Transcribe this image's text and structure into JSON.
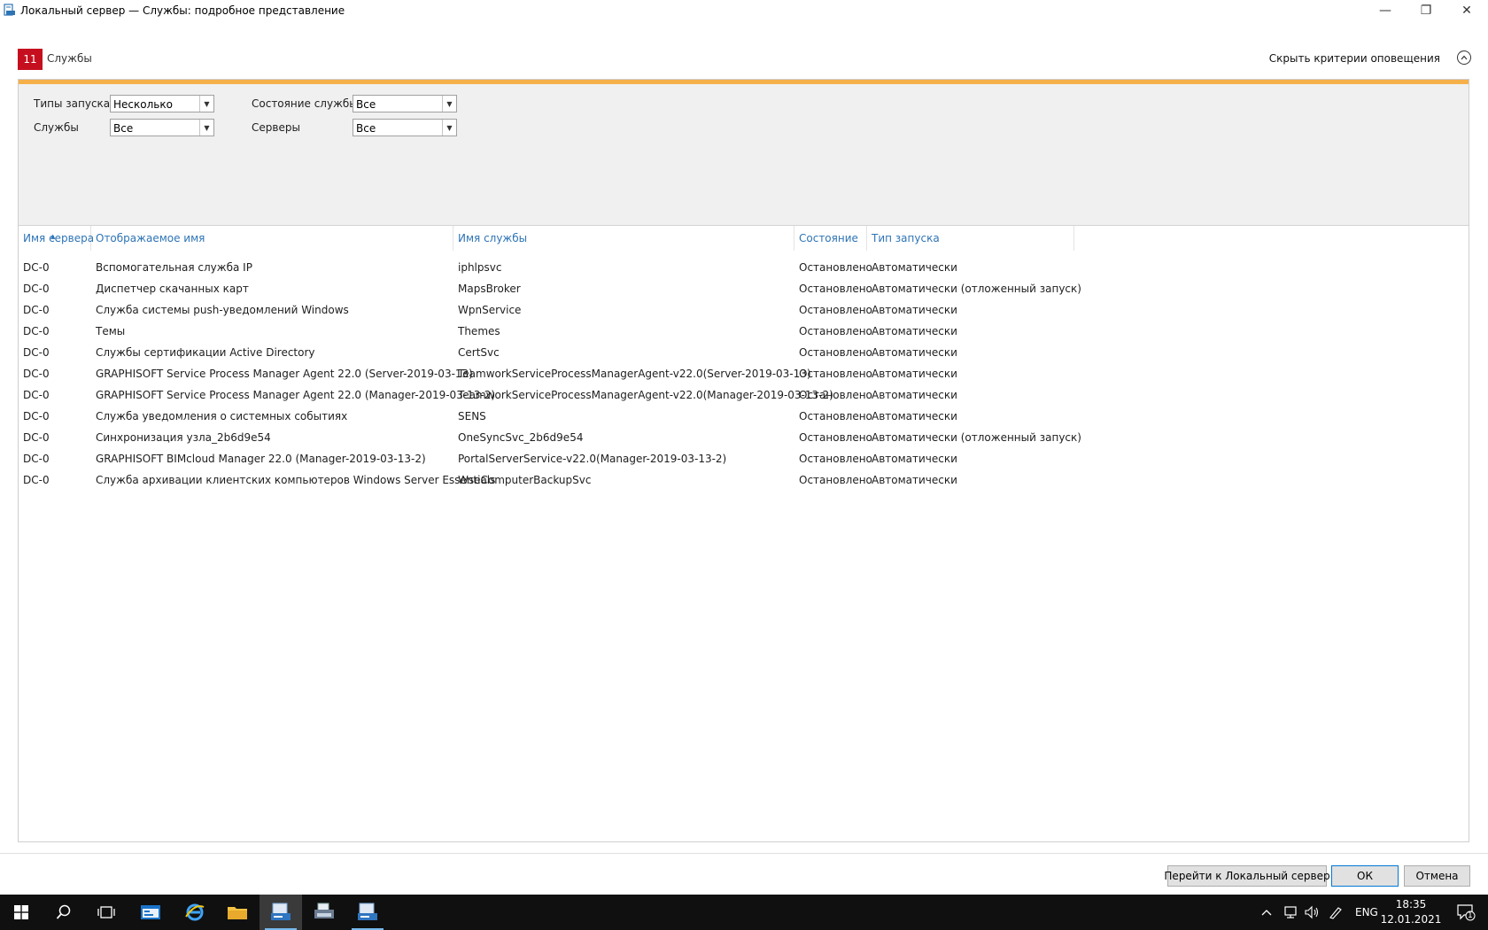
{
  "window": {
    "title": "Локальный сервер — Службы: подробное представление",
    "minimize": "—",
    "maximize": "❐",
    "close": "✕"
  },
  "header": {
    "count": "11",
    "section": "Службы",
    "hide_criteria": "Скрыть критерии оповещения"
  },
  "filters": {
    "startup_types_label": "Типы запуска",
    "startup_types_value": "Несколько",
    "service_state_label": "Состояние службы",
    "service_state_value": "Все",
    "services_label": "Службы",
    "services_value": "Все",
    "servers_label": "Серверы",
    "servers_value": "Все"
  },
  "table": {
    "columns": [
      "Имя сервера",
      "Отображаемое имя",
      "Имя службы",
      "Состояние",
      "Тип запуска"
    ],
    "rows": [
      [
        "DC-0",
        "Вспомогательная служба IP",
        "iphlpsvc",
        "Остановлено",
        "Автоматически"
      ],
      [
        "DC-0",
        "Диспетчер скачанных карт",
        "MapsBroker",
        "Остановлено",
        "Автоматически (отложенный запуск)"
      ],
      [
        "DC-0",
        "Служба системы push-уведомлений Windows",
        "WpnService",
        "Остановлено",
        "Автоматически"
      ],
      [
        "DC-0",
        "Темы",
        "Themes",
        "Остановлено",
        "Автоматически"
      ],
      [
        "DC-0",
        "Службы сертификации Active Directory",
        "CertSvc",
        "Остановлено",
        "Автоматически"
      ],
      [
        "DC-0",
        "GRAPHISOFT Service Process Manager Agent 22.0 (Server-2019-03-13)",
        "TeamworkServiceProcessManagerAgent-v22.0(Server-2019-03-13)",
        "Остановлено",
        "Автоматически"
      ],
      [
        "DC-0",
        "GRAPHISOFT Service Process Manager Agent 22.0 (Manager-2019-03-13-2)",
        "TeamworkServiceProcessManagerAgent-v22.0(Manager-2019-03-13-2)",
        "Остановлено",
        "Автоматически"
      ],
      [
        "DC-0",
        "Служба уведомления о системных событиях",
        "SENS",
        "Остановлено",
        "Автоматически"
      ],
      [
        "DC-0",
        "Синхронизация узла_2b6d9e54",
        "OneSyncSvc_2b6d9e54",
        "Остановлено",
        "Автоматически (отложенный запуск)"
      ],
      [
        "DC-0",
        "GRAPHISOFT BIMcloud Manager 22.0 (Manager-2019-03-13-2)",
        "PortalServerService-v22.0(Manager-2019-03-13-2)",
        "Остановлено",
        "Автоматически"
      ],
      [
        "DC-0",
        "Служба архивации клиентских компьютеров Windows Server Essentials",
        "WseComputerBackupSvc",
        "Остановлено",
        "Автоматически"
      ]
    ]
  },
  "footer": {
    "goto_button": "Перейти к Локальный сервер",
    "ok_button": "ОК",
    "cancel_button": "Отмена"
  },
  "taskbar": {
    "language": "ENG",
    "time": "18:35",
    "date": "12.01.2021",
    "notification_count": "1"
  },
  "colors": {
    "badge": "#c50f1f",
    "accent_bar": "#f6b04a",
    "header_link": "#2e74b5",
    "taskbar": "#101010"
  }
}
